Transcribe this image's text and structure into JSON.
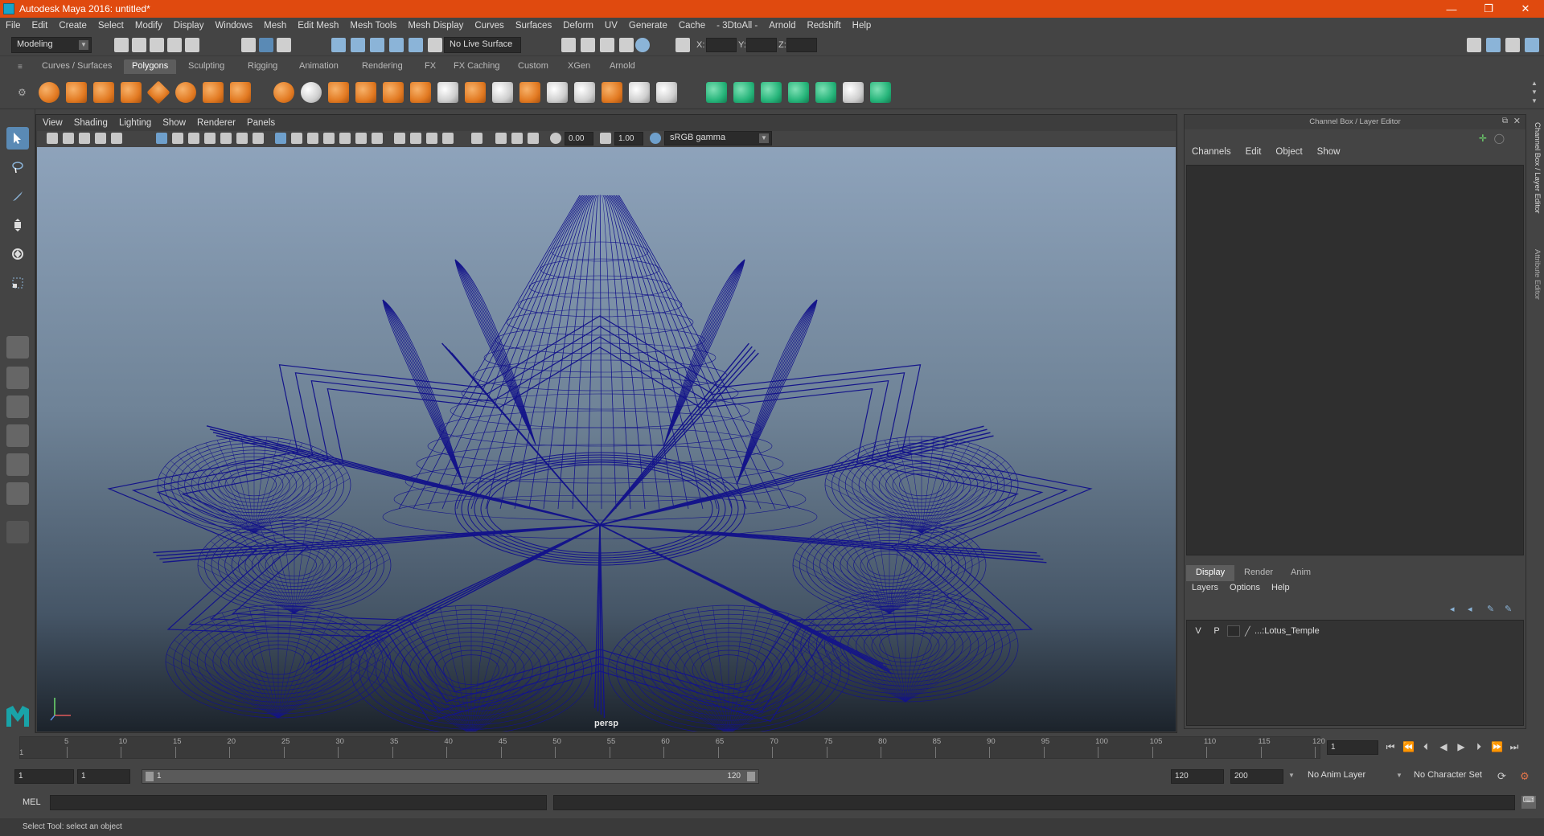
{
  "window": {
    "title": "Autodesk Maya 2016: untitled*",
    "controls": [
      "—",
      "❐",
      "✕"
    ]
  },
  "menubar": [
    "File",
    "Edit",
    "Create",
    "Select",
    "Modify",
    "Display",
    "Windows",
    "Mesh",
    "Edit Mesh",
    "Mesh Tools",
    "Mesh Display",
    "Curves",
    "Surfaces",
    "Deform",
    "UV",
    "Generate",
    "Cache",
    "- 3DtoAll -",
    "Arnold",
    "Redshift",
    "Help"
  ],
  "statusline": {
    "mode": "Modeling",
    "live_surface": "No Live Surface",
    "x_label": "X:",
    "y_label": "Y:",
    "z_label": "Z:"
  },
  "shelf_tabs": [
    "Curves / Surfaces",
    "Polygons",
    "Sculpting",
    "Rigging",
    "Animation",
    "Rendering",
    "FX",
    "FX Caching",
    "Custom",
    "XGen",
    "Arnold"
  ],
  "shelf_active": "Polygons",
  "viewport": {
    "menu": [
      "View",
      "Shading",
      "Lighting",
      "Show",
      "Renderer",
      "Panels"
    ],
    "exposure": "0.00",
    "gamma": "1.00",
    "color_space": "sRGB gamma",
    "camera_label": "persp",
    "wire_color": "#14148a"
  },
  "channel_box": {
    "header": "Channel Box / Layer Editor",
    "menu": [
      "Channels",
      "Edit",
      "Object",
      "Show"
    ],
    "layer_tabs": [
      "Display",
      "Render",
      "Anim"
    ],
    "layer_menu": [
      "Layers",
      "Options",
      "Help"
    ],
    "layer": {
      "v": "V",
      "p": "P",
      "name": "...:Lotus_Temple"
    }
  },
  "side_tabs": [
    "Channel Box / Layer Editor",
    "Attribute Editor"
  ],
  "timeslider": {
    "ticks": [
      "5",
      "10",
      "15",
      "20",
      "25",
      "30",
      "35",
      "40",
      "45",
      "50",
      "55",
      "60",
      "65",
      "70",
      "75",
      "80",
      "85",
      "90",
      "95",
      "100",
      "105",
      "110",
      "115",
      "120"
    ],
    "start_marker": "1",
    "current_frame": "1"
  },
  "range": {
    "start": "1",
    "playback_start": "1",
    "slider_start": "1",
    "slider_end": "120",
    "playback_end": "120",
    "end": "200",
    "anim_layer": "No Anim Layer",
    "character_set": "No Character Set"
  },
  "cmdline": {
    "label": "MEL"
  },
  "helpline": {
    "text": "Select Tool: select an object"
  }
}
